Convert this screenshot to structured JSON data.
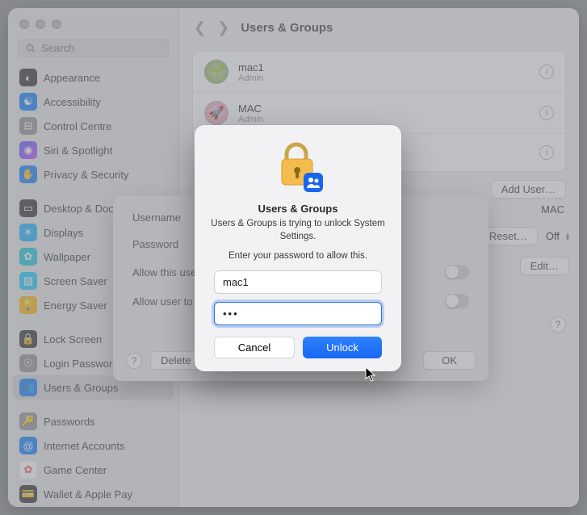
{
  "search": {
    "placeholder": "Search"
  },
  "sidebar": {
    "items": [
      {
        "label": "Appearance"
      },
      {
        "label": "Accessibility"
      },
      {
        "label": "Control Centre"
      },
      {
        "label": "Siri & Spotlight"
      },
      {
        "label": "Privacy & Security"
      },
      {
        "label": "Desktop & Dock"
      },
      {
        "label": "Displays"
      },
      {
        "label": "Wallpaper"
      },
      {
        "label": "Screen Saver"
      },
      {
        "label": "Energy Saver"
      },
      {
        "label": "Lock Screen"
      },
      {
        "label": "Login Password"
      },
      {
        "label": "Users & Groups"
      },
      {
        "label": "Passwords"
      },
      {
        "label": "Internet Accounts"
      },
      {
        "label": "Game Center"
      },
      {
        "label": "Wallet & Apple Pay"
      }
    ]
  },
  "title": "Users & Groups",
  "users": [
    {
      "name": "mac1",
      "role": "Admin"
    },
    {
      "name": "MAC",
      "role": "Admin"
    }
  ],
  "buttons": {
    "add_user": "Add User…",
    "reset": "Reset…",
    "edit": "Edit…",
    "delete_user": "Delete User…",
    "ok": "OK",
    "cancel": "Cancel",
    "unlock": "Unlock"
  },
  "sheet": {
    "username_label": "Username",
    "username_value": "MAC",
    "password_label": "Password",
    "allow_admin": "Allow this user",
    "allow_user": "Allow user to"
  },
  "edge": {
    "off_label": "Off"
  },
  "dialog": {
    "title": "Users & Groups",
    "message": "Users & Groups is trying to unlock System Settings.",
    "sub": "Enter your password to allow this.",
    "username": "mac1",
    "password_mask": "•••"
  }
}
